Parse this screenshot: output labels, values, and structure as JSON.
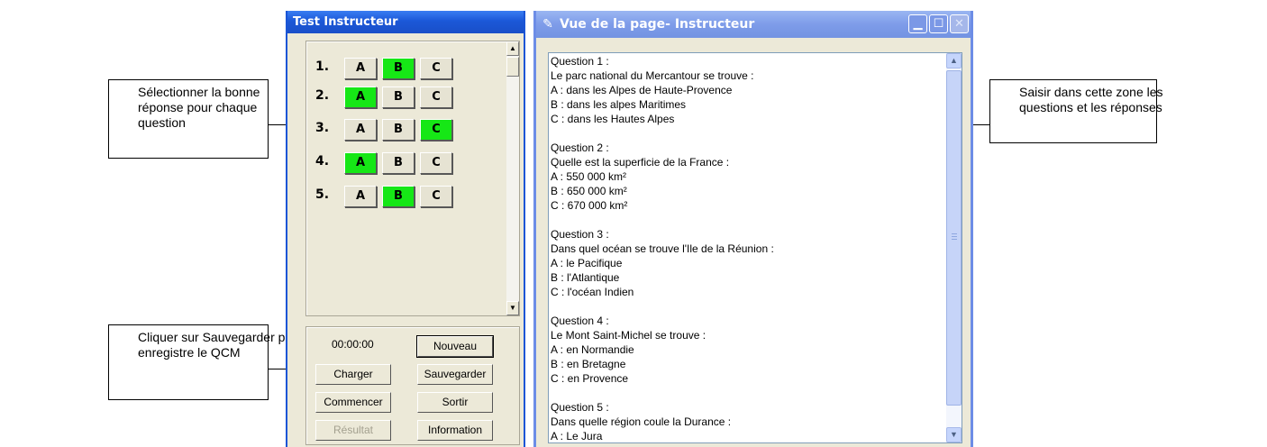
{
  "callouts": {
    "select_answer": [
      "Sélectionner la bonne",
      "réponse pour chaque",
      "question"
    ],
    "save": [
      "Cliquer sur Sauvegarder pour",
      "enregistre le QCM"
    ],
    "input_zone": [
      "Saisir dans cette zone les",
      "questions et les réponses"
    ]
  },
  "left_window": {
    "title": "Test Instructeur",
    "questions": [
      {
        "num": "1.",
        "selected": "B"
      },
      {
        "num": "2.",
        "selected": "A"
      },
      {
        "num": "3.",
        "selected": "C"
      },
      {
        "num": "4.",
        "selected": "A"
      },
      {
        "num": "5.",
        "selected": "B"
      }
    ],
    "answer_labels": [
      "A",
      "B",
      "C"
    ],
    "highlight_color": "#16e716",
    "timer": "00:00:00",
    "buttons": {
      "nouveau": "Nouveau",
      "charger": "Charger",
      "sauvegarder": "Sauvegarder",
      "commencer": "Commencer",
      "sortir": "Sortir",
      "resultat": "Résultat",
      "information": "Information"
    }
  },
  "right_window": {
    "title": "Vue de la page- Instructeur",
    "lines": [
      "Question 1 :",
      "Le parc national du Mercantour se trouve :",
      "A : dans les Alpes de Haute-Provence",
      "B : dans les alpes Maritimes",
      "C : dans les Hautes Alpes",
      "",
      "Question 2 :",
      "Quelle est la superficie de la France :",
      "A : 550 000 km²",
      "B : 650 000 km²",
      "C : 670 000 km²",
      "",
      "Question 3 :",
      "Dans quel océan se trouve l'Ile de la Réunion :",
      "A : le Pacifique",
      "B : l'Atlantique",
      "C : l'océan Indien",
      "",
      "Question 4 :",
      "Le Mont Saint-Michel se trouve :",
      "A : en Normandie",
      "B : en Bretagne",
      "C : en Provence",
      "",
      "Question 5 :",
      "Dans quelle région coule la Durance :",
      "A : Le Jura"
    ]
  }
}
